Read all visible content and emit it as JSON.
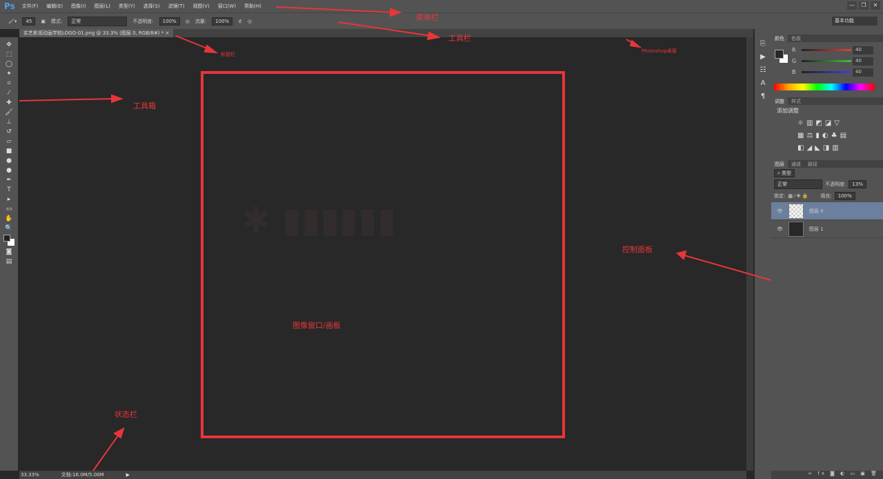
{
  "app": {
    "logo": "Ps",
    "menus": [
      "文件(F)",
      "编辑(E)",
      "图像(I)",
      "图层(L)",
      "类型(Y)",
      "选择(S)",
      "滤镜(T)",
      "视图(V)",
      "窗口(W)",
      "帮助(H)"
    ],
    "window_buttons": [
      "—",
      "❐",
      "✕"
    ]
  },
  "options": {
    "brush_size": "45",
    "mode_label": "模式:",
    "mode_value": "正常",
    "opacity_label": "不透明度:",
    "opacity_value": "100%",
    "flow_label": "流量:",
    "flow_value": "100%",
    "workspace": "基本功能"
  },
  "document": {
    "tab_title": "实艺影视动画学校LOGO-01.png @ 33.3% (图层 0, RGB/8#) *",
    "close": "×"
  },
  "status": {
    "zoom": "33.33%",
    "doc_info": "文档:16.0M/5.00M"
  },
  "panels": {
    "color_tabs": [
      "颜色",
      "色板"
    ],
    "channels": [
      {
        "label": "R",
        "value": "40",
        "color": "#e04040"
      },
      {
        "label": "G",
        "value": "40",
        "color": "#40c040"
      },
      {
        "label": "B",
        "value": "40",
        "color": "#4040e0"
      }
    ],
    "adjust_tabs": [
      "调整",
      "样式"
    ],
    "adjust_title": "添加调整",
    "layer_tabs": [
      "图层",
      "通道",
      "路径"
    ],
    "filter_kind": "类型",
    "blend_mode": "正常",
    "opacity_label": "不透明度:",
    "opacity_value": "13%",
    "lock_label": "锁定:",
    "fill_label": "填充:",
    "fill_value": "100%",
    "layers": [
      {
        "name": "图层 0",
        "selected": true
      },
      {
        "name": "图层 1",
        "selected": false
      }
    ]
  },
  "annotations": {
    "menubar": "菜单栏",
    "toolbar": "工具栏",
    "titlebar": "标题栏",
    "desktop": "Photoshop桌面",
    "toolbox": "工具箱",
    "panels": "控制面板",
    "canvas": "图像窗口/画板",
    "statusbar": "状态栏",
    "color": "#e8353a"
  }
}
